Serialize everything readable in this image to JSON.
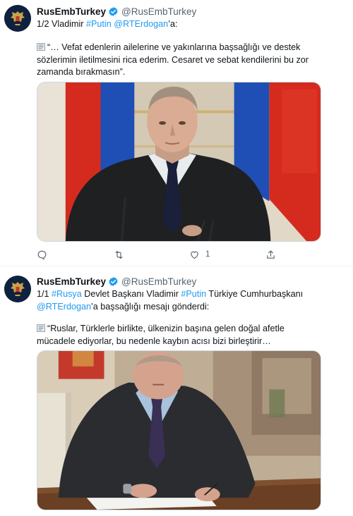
{
  "tweets": [
    {
      "author_name": "RusEmbTurkey",
      "author_handle": "@RusEmbTurkey",
      "line1_prefix": "1/2 Vladimir ",
      "hashtag": "#Putin",
      "mention": "@RTErdogan",
      "line1_suffix": "’a:",
      "quote": "“… Vefat edenlerin ailelerine ve yakınlarına başsağlığı ve destek sözlerimin iletilmesini rica ederim. Cesaret ve sebat kendilerini bu zor zamanda bırakmasın”.",
      "actions": {
        "reply_count": "",
        "retweet_count": "",
        "like_count": "1",
        "share_count": ""
      }
    },
    {
      "author_name": "RusEmbTurkey",
      "author_handle": "@RusEmbTurkey",
      "line1_prefix": "1/1 ",
      "hashtag_1": "#Rusya",
      "middle": " Devlet Başkanı Vladimir ",
      "hashtag_2": "#Putin",
      "line1_suffix": " Türkiye Cumhurbaşkanı",
      "mention": "@RTErdogan",
      "line2_suffix": "’a başsağlığı mesajı gönderdi:",
      "quote": "“Ruslar, Türklerle birlikte, ülkenizin başına gelen doğal afetle mücadele ediyorlar, bu nedenle kaybın acısı bizi birleştirir…"
    }
  ],
  "icons": {
    "avatar": "coat-of-arms-icon",
    "verified": "verified-badge-icon",
    "document": "document-icon",
    "reply": "reply-icon",
    "retweet": "retweet-icon",
    "like": "heart-icon",
    "share": "share-icon"
  },
  "colors": {
    "link": "#1d9bf0",
    "secondary_text": "#536471",
    "verified": "#1d9bf0"
  }
}
